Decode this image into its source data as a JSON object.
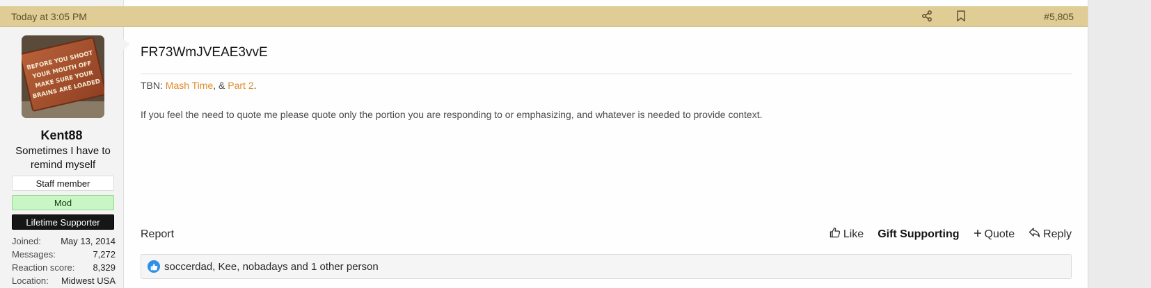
{
  "header": {
    "date": "Today at 3:05 PM",
    "post_number": "#5,805",
    "icons": [
      "share-icon",
      "bookmark-icon"
    ]
  },
  "user": {
    "avatar_sign_text": [
      "BEFORE YOU SHOOT",
      "YOUR MOUTH OFF",
      "MAKE SURE YOUR",
      "BRAINS ARE LOADED"
    ],
    "name": "Kent88",
    "title": "Sometimes I have to remind myself",
    "banners": {
      "staff": "Staff member",
      "mod": "Mod",
      "lifetime": "Lifetime Supporter"
    },
    "stats": [
      {
        "label": "Joined:",
        "value": "May 13, 2014"
      },
      {
        "label": "Messages:",
        "value": "7,272"
      },
      {
        "label": "Reaction score:",
        "value": "8,329"
      },
      {
        "label": "Location:",
        "value": "Midwest USA"
      }
    ]
  },
  "post": {
    "body": "FR73WmJVEAE3vvE",
    "signature": {
      "prefix": "TBN: ",
      "link1": "Mash Time",
      "sep": ", & ",
      "link2": "Part 2",
      "suffix": ".",
      "note": "If you feel the need to quote me please quote only the portion you are responding to or emphasizing, and whatever is needed to provide context."
    }
  },
  "actions": {
    "report": "Report",
    "like": "Like",
    "gift": "Gift Supporting",
    "quote": "Quote",
    "reply": "Reply"
  },
  "reactions": {
    "text": "soccerdad, Kee, nobadays and 1 other person"
  },
  "colors": {
    "header_bg": "#dfcd95",
    "link": "#e08a28",
    "mod_banner": "#c8f7c5",
    "like_badge": "#2d8fe6"
  }
}
